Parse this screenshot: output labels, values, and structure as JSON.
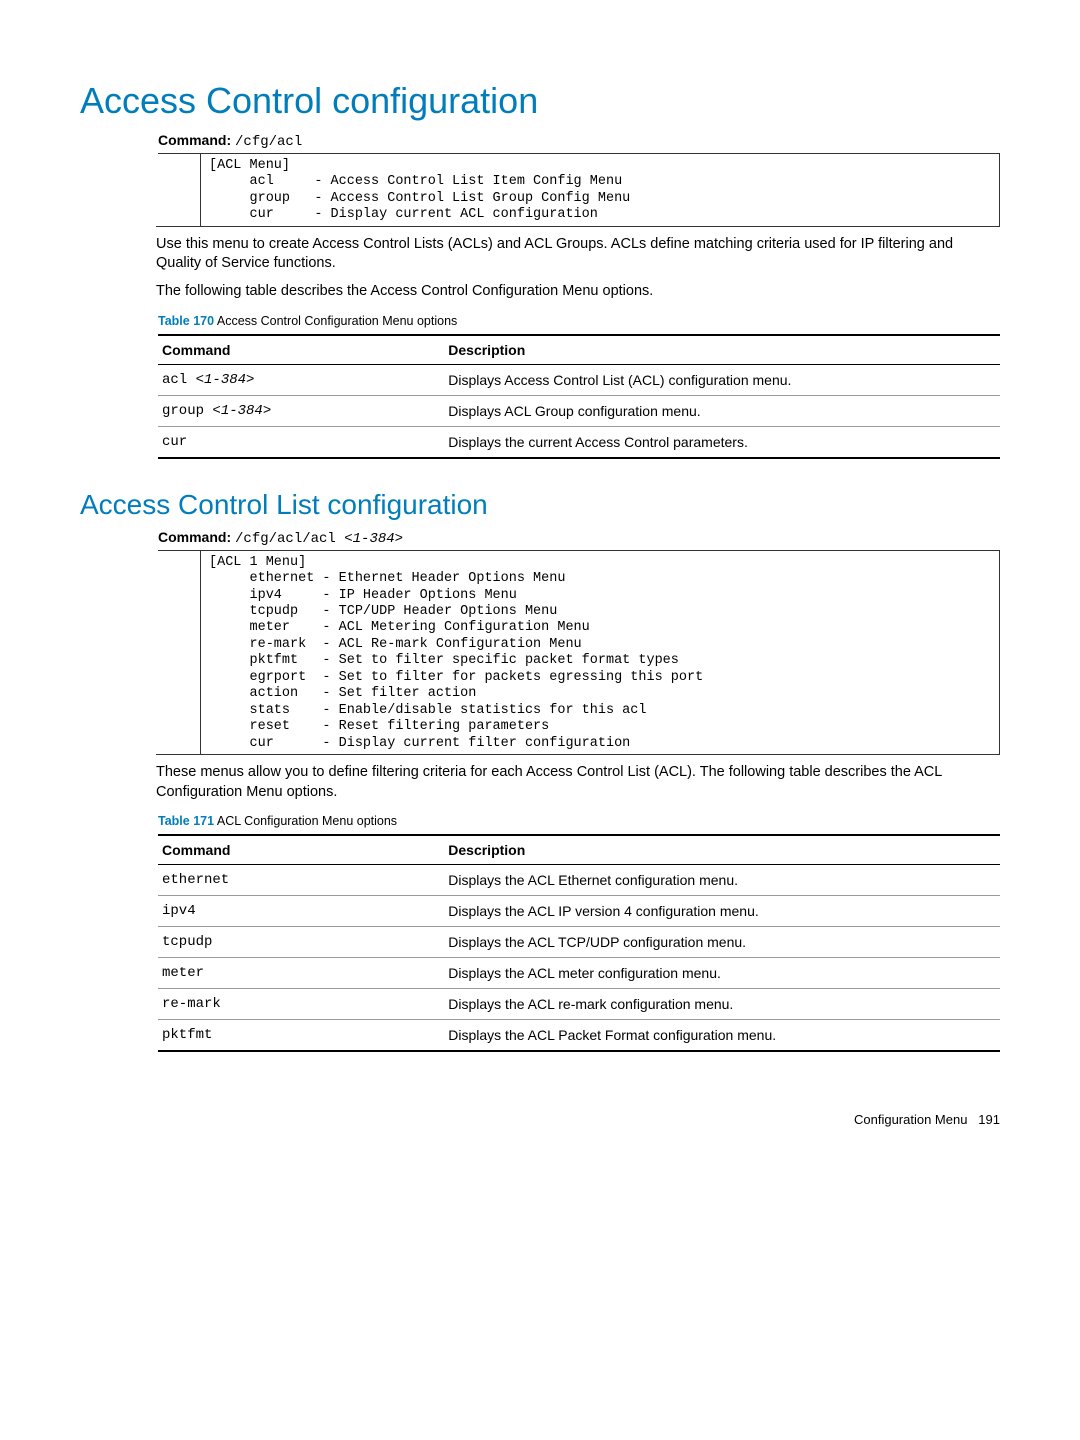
{
  "h1": "Access Control configuration",
  "cmd1": {
    "label": "Command:",
    "path": "/cfg/acl"
  },
  "code1": "[ACL Menu]\n     acl     - Access Control List Item Config Menu\n     group   - Access Control List Group Config Menu\n     cur     - Display current ACL configuration",
  "para1": "Use this menu to create Access Control Lists (ACLs) and ACL Groups. ACLs define matching criteria used for IP filtering and Quality of Service functions.",
  "para2": "The following table describes the Access Control Configuration Menu options.",
  "table1": {
    "caption_label": "Table 170",
    "caption_text": "Access Control Configuration Menu options",
    "head_cmd": "Command",
    "head_desc": "Description",
    "rows": [
      {
        "cmd": "acl ",
        "param": "<1-384>",
        "desc": "Displays Access Control List (ACL) configuration menu."
      },
      {
        "cmd": "group ",
        "param": "<1-384>",
        "desc": "Displays ACL Group configuration menu."
      },
      {
        "cmd": "cur",
        "param": "",
        "desc": "Displays the current Access Control parameters."
      }
    ]
  },
  "h2": "Access Control List configuration",
  "cmd2": {
    "label": "Command:",
    "path_plain": "/cfg/acl/acl ",
    "path_param": "<1-384>"
  },
  "code2": "[ACL 1 Menu]\n     ethernet - Ethernet Header Options Menu\n     ipv4     - IP Header Options Menu\n     tcpudp   - TCP/UDP Header Options Menu\n     meter    - ACL Metering Configuration Menu\n     re-mark  - ACL Re-mark Configuration Menu\n     pktfmt   - Set to filter specific packet format types\n     egrport  - Set to filter for packets egressing this port\n     action   - Set filter action\n     stats    - Enable/disable statistics for this acl\n     reset    - Reset filtering parameters\n     cur      - Display current filter configuration",
  "para3": "These menus allow you to define filtering criteria for each Access Control List (ACL). The following table describes the ACL Configuration Menu options.",
  "table2": {
    "caption_label": "Table 171",
    "caption_text": "ACL Configuration Menu options",
    "head_cmd": "Command",
    "head_desc": "Description",
    "rows": [
      {
        "cmd": "ethernet",
        "desc": "Displays the ACL Ethernet configuration menu."
      },
      {
        "cmd": "ipv4",
        "desc": "Displays the ACL IP version 4 configuration menu."
      },
      {
        "cmd": "tcpudp",
        "desc": "Displays the ACL TCP/UDP configuration menu."
      },
      {
        "cmd": "meter",
        "desc": "Displays the ACL meter configuration menu."
      },
      {
        "cmd": "re-mark",
        "desc": "Displays the ACL re-mark configuration menu."
      },
      {
        "cmd": "pktfmt",
        "desc": "Displays the ACL Packet Format configuration menu."
      }
    ]
  },
  "footer": {
    "text": "Configuration Menu",
    "page": "191"
  }
}
